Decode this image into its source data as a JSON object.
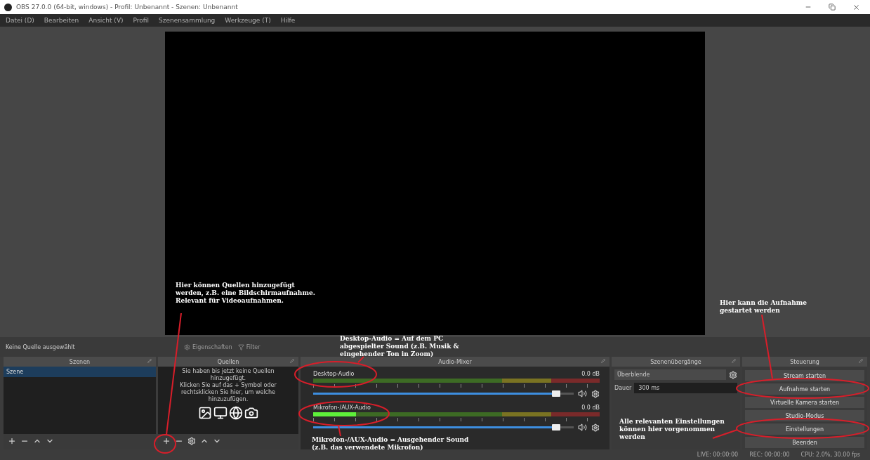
{
  "window": {
    "title": "OBS 27.0.0 (64-bit, windows) - Profil: Unbenannt - Szenen: Unbenannt"
  },
  "menu": [
    "Datei (D)",
    "Bearbeiten",
    "Ansicht (V)",
    "Profil",
    "Szenensammlung",
    "Werkzeuge (T)",
    "Hilfe"
  ],
  "source_toolbar": {
    "status": "Keine Quelle ausgewählt",
    "buttons": [
      {
        "label": "Eigenschaften",
        "disabled": true
      },
      {
        "label": "Filter",
        "disabled": true
      }
    ]
  },
  "scenes": {
    "title": "Szenen",
    "items": [
      {
        "label": "Szene",
        "selected": true
      }
    ]
  },
  "sources": {
    "title": "Quellen",
    "empty_message": [
      "Sie haben bis jetzt keine Quellen hinzugefügt.",
      "Klicken Sie auf das + Symbol oder rechtsklicken Sie hier, um welche hinzuzufügen."
    ]
  },
  "mixer": {
    "title": "Audio-Mixer",
    "channels": [
      {
        "name": "Desktop-Audio",
        "reading": "0.0 dB",
        "fader": {
          "level": 0.95
        }
      },
      {
        "name": "Mikrofon-/AUX-Audio",
        "reading": "0.0 dB",
        "meter": {
          "level": 0.15
        },
        "fader": {
          "level": 0.95
        }
      }
    ]
  },
  "transitions": {
    "title": "Szenenübergänge",
    "transition": "Überblende",
    "duration_label": "Dauer",
    "duration": "300 ms"
  },
  "controls": {
    "title": "Steuerung",
    "buttons": [
      "Stream starten",
      "Aufnahme starten",
      "Virtuelle Kamera starten",
      "Studio-Modus",
      "Einstellungen",
      "Beenden"
    ]
  },
  "status_bar": [
    "LIVE: 00:00:00",
    "REC: 00:00:00",
    "CPU: 2.0%, 30.00 fps"
  ],
  "annotations": [
    {
      "text": "Hier können Quellen hinzugefügt werden, z.B. eine Bildschirmaufnahme. Relevant für Videoaufnahmen."
    },
    {
      "text": "Desktop-Audio = Auf dem PC abgespielter Sound (z.B. Musik & eingehender Ton in Zoom)"
    },
    {
      "text": "Mikrofon-/AUX-Audio = Ausgehender Sound (z.B. das verwendete Mikrofon)"
    },
    {
      "text": "Hier kann die Aufnahme gestartet werden"
    },
    {
      "text": "Alle relevanten Einstellungen können hier vorgenommen werden"
    }
  ]
}
